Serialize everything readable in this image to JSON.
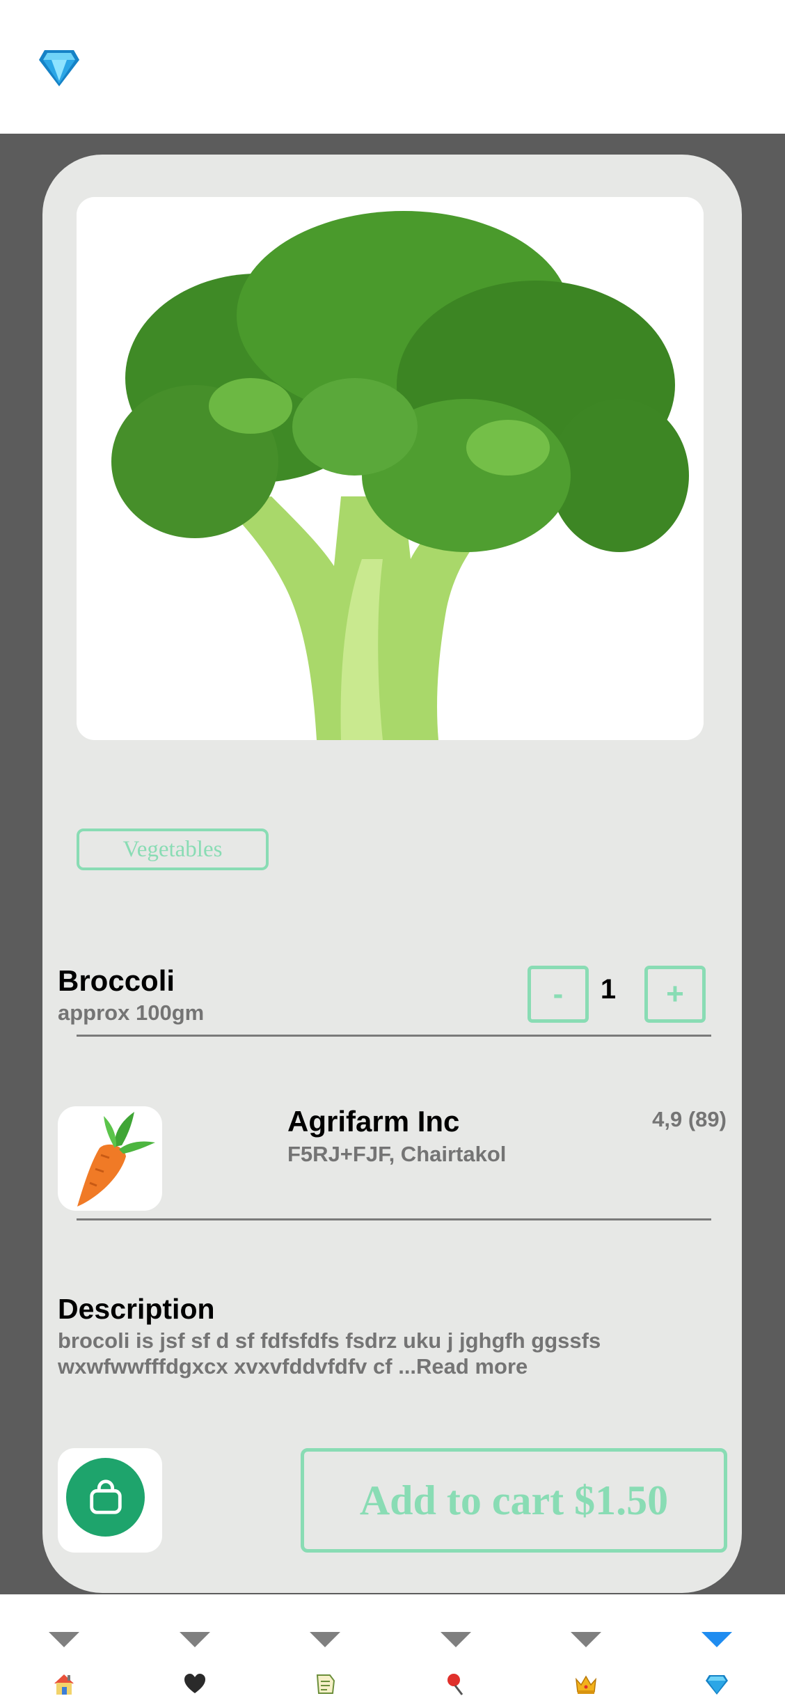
{
  "header": {
    "logo_icon": "gem-icon"
  },
  "product": {
    "image_icon": "broccoli-image",
    "category": "Vegetables",
    "name": "Broccoli",
    "subtitle": "approx 100gm",
    "quantity": "1",
    "decrement_label": "-",
    "increment_label": "+"
  },
  "seller": {
    "logo_icon": "carrot-icon",
    "name": "Agrifarm Inc",
    "address": "F5RJ+FJF, Chairtakol",
    "rating": "4,9 (89)"
  },
  "description": {
    "title": "Description",
    "text": "brocoli is jsf sf  d sf  fdfsfdfs fsdrz uku j jghgfh ggssfs wxwfwwfffdgxcx xvxvfddvfdfv cf ...Read more"
  },
  "actions": {
    "bag_icon": "shopping-bag-icon",
    "add_to_cart_label": "Add to cart $1.50"
  },
  "bottom_nav": {
    "items": [
      {
        "icon": "house-icon",
        "active": false
      },
      {
        "icon": "heart-icon",
        "active": false
      },
      {
        "icon": "receipt-icon",
        "active": false
      },
      {
        "icon": "pin-icon",
        "active": false
      },
      {
        "icon": "crown-icon",
        "active": false
      },
      {
        "icon": "gem-icon",
        "active": true
      }
    ]
  },
  "colors": {
    "accent": "#89dcb4",
    "bag_green": "#1ea46c",
    "active_nav": "#1f8cf0",
    "backdrop": "#5c5c5c",
    "card": "#e7e8e6"
  }
}
